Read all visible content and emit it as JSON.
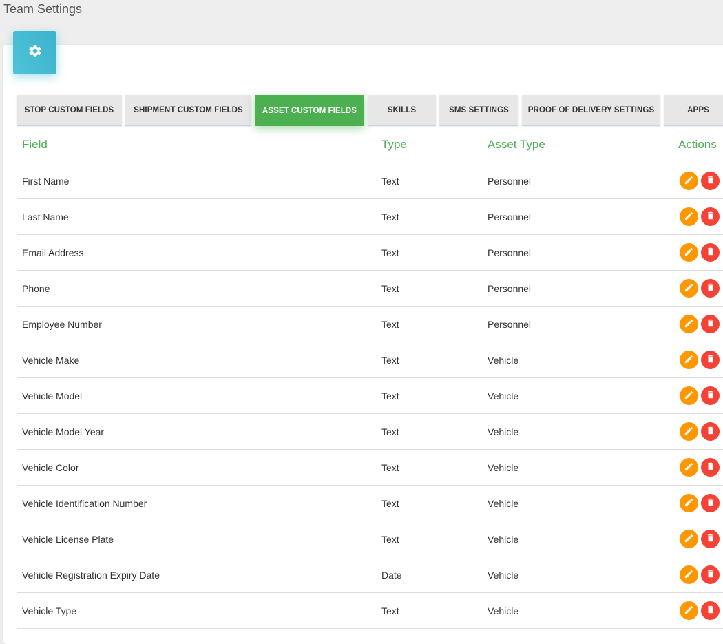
{
  "page": {
    "title": "Team Settings"
  },
  "card": {
    "icon": "gear-icon"
  },
  "tabs": [
    {
      "label": "STOP CUSTOM FIELDS",
      "active": false
    },
    {
      "label": "SHIPMENT CUSTOM FIELDS",
      "active": false
    },
    {
      "label": "ASSET CUSTOM FIELDS",
      "active": true
    },
    {
      "label": "SKILLS",
      "active": false
    },
    {
      "label": "SMS SETTINGS",
      "active": false
    },
    {
      "label": "PROOF OF DELIVERY SETTINGS",
      "active": false
    },
    {
      "label": "APPS",
      "active": false
    }
  ],
  "table": {
    "headers": {
      "field": "Field",
      "type": "Type",
      "asset_type": "Asset Type",
      "actions": "Actions"
    },
    "rows": [
      {
        "field": "First Name",
        "type": "Text",
        "asset_type": "Personnel"
      },
      {
        "field": "Last Name",
        "type": "Text",
        "asset_type": "Personnel"
      },
      {
        "field": "Email Address",
        "type": "Text",
        "asset_type": "Personnel"
      },
      {
        "field": "Phone",
        "type": "Text",
        "asset_type": "Personnel"
      },
      {
        "field": "Employee Number",
        "type": "Text",
        "asset_type": "Personnel"
      },
      {
        "field": "Vehicle Make",
        "type": "Text",
        "asset_type": "Vehicle"
      },
      {
        "field": "Vehicle Model",
        "type": "Text",
        "asset_type": "Vehicle"
      },
      {
        "field": "Vehicle Model Year",
        "type": "Text",
        "asset_type": "Vehicle"
      },
      {
        "field": "Vehicle Color",
        "type": "Text",
        "asset_type": "Vehicle"
      },
      {
        "field": "Vehicle Identification Number",
        "type": "Text",
        "asset_type": "Vehicle"
      },
      {
        "field": "Vehicle License Plate",
        "type": "Text",
        "asset_type": "Vehicle"
      },
      {
        "field": "Vehicle Registration Expiry Date",
        "type": "Date",
        "asset_type": "Vehicle"
      },
      {
        "field": "Vehicle Type",
        "type": "Text",
        "asset_type": "Vehicle"
      }
    ],
    "row_actions": [
      "edit-icon",
      "delete-icon"
    ]
  },
  "colors": {
    "accent_green": "#4caf50",
    "icon_teal": "#3cb2cc",
    "edit_orange": "#ff9800",
    "delete_red": "#f44336"
  }
}
